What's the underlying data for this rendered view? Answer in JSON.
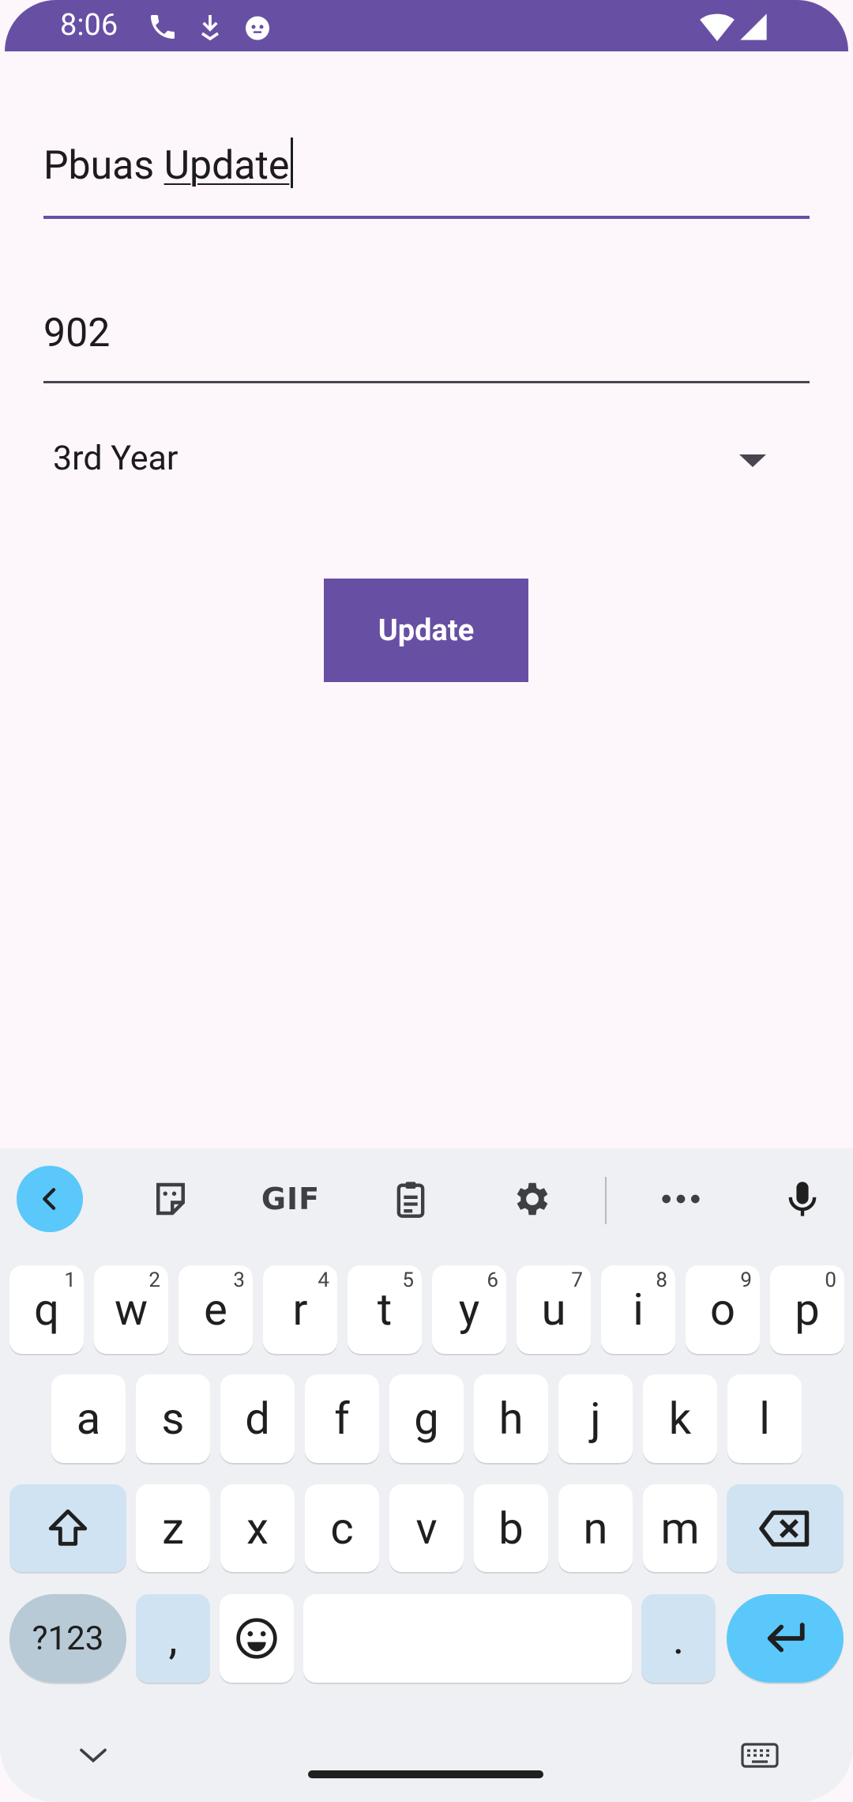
{
  "status_bar": {
    "time": "8:06",
    "icons": [
      "phone-icon",
      "download-icon",
      "cat-icon",
      "wifi-icon",
      "signal-icon"
    ],
    "color": "#6750a4"
  },
  "form": {
    "name_field": {
      "value_first": "Pbuas",
      "value_second": "Update"
    },
    "number_field": {
      "value": "902"
    },
    "year_spinner": {
      "selected": "3rd Year"
    },
    "update_button": {
      "label": "Update"
    },
    "accent": "#6750a4"
  },
  "keyboard": {
    "toolbar": [
      "back-icon",
      "sticker-icon",
      "gif-icon",
      "clipboard-icon",
      "settings-icon",
      "more-icon",
      "mic-icon"
    ],
    "gif_label": "GIF",
    "row1": [
      {
        "k": "q",
        "h": "1"
      },
      {
        "k": "w",
        "h": "2"
      },
      {
        "k": "e",
        "h": "3"
      },
      {
        "k": "r",
        "h": "4"
      },
      {
        "k": "t",
        "h": "5"
      },
      {
        "k": "y",
        "h": "6"
      },
      {
        "k": "u",
        "h": "7"
      },
      {
        "k": "i",
        "h": "8"
      },
      {
        "k": "o",
        "h": "9"
      },
      {
        "k": "p",
        "h": "0"
      }
    ],
    "row2": [
      "a",
      "s",
      "d",
      "f",
      "g",
      "h",
      "j",
      "k",
      "l"
    ],
    "row3": [
      "z",
      "x",
      "c",
      "v",
      "b",
      "n",
      "m"
    ],
    "sym_label": "?123",
    "comma": ",",
    "period": ".",
    "accent": "#5ac8fa"
  }
}
